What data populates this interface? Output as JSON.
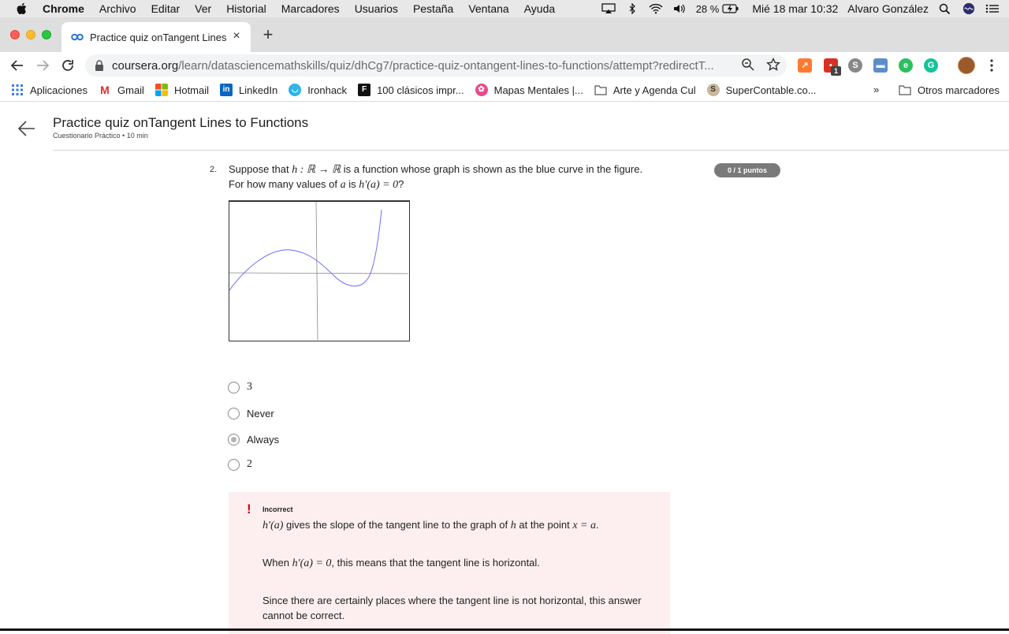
{
  "menubar": {
    "app": "Chrome",
    "items": [
      "Archivo",
      "Editar",
      "Ver",
      "Historial",
      "Marcadores",
      "Usuarios",
      "Pestaña",
      "Ventana",
      "Ayuda"
    ],
    "battery": "28 %",
    "datetime": "Mié 18 mar  10:32",
    "user": "Alvaro González"
  },
  "tab": {
    "title": "Practice quiz onTangent Lines",
    "close": "×",
    "new_tab": "+"
  },
  "omnibox": {
    "host": "coursera.org",
    "path": "/learn/datasciencemathskills/quiz/dhCg7/practice-quiz-ontangent-lines-to-functions/attempt?redirectT..."
  },
  "extensions": {
    "badge_count": "1"
  },
  "bookmarks": {
    "items": [
      "Aplicaciones",
      "Gmail",
      "Hotmail",
      "LinkedIn",
      "Ironhack",
      "100 clásicos impr...",
      "Mapas Mentales |...",
      "Arte y Agenda Cul",
      "SuperContable.co..."
    ],
    "more": "»",
    "other": "Otros marcadores"
  },
  "page": {
    "title": "Practice quiz onTangent Lines to Functions",
    "meta": "Cuestionario Práctico • 10 min"
  },
  "question": {
    "number": "2.",
    "line1_pre": "Suppose that ",
    "line1_math": "h : ℝ → ℝ",
    "line1_post": "  is a function whose graph is shown as the blue curve in the figure.",
    "line2_pre": "For how many values of ",
    "line2_var": "a",
    "line2_mid": " is ",
    "line2_math": "h′(a) = 0",
    "line2_post": "?",
    "points": "0 / 1 puntos",
    "curve_color": "#6b6bff"
  },
  "options": [
    {
      "label": "3",
      "selected": false
    },
    {
      "label": "Never",
      "selected": false
    },
    {
      "label": "Always",
      "selected": true
    },
    {
      "label": "2",
      "selected": false
    }
  ],
  "feedback": {
    "mark": "!",
    "status": "Incorrect",
    "p1_math": "h′(a)",
    "p1_text": " gives the slope of the tangent line to the graph of ",
    "p1_var": "h",
    "p1_text2": " at the point ",
    "p1_math2": "x = a",
    "p1_end": ".",
    "p2_pre": "When ",
    "p2_math": "h′(a) = 0",
    "p2_post": ", this means that the tangent line is horizontal.",
    "p3": "Since there are certainly places where the tangent line is not horizontal, this answer cannot be correct."
  }
}
